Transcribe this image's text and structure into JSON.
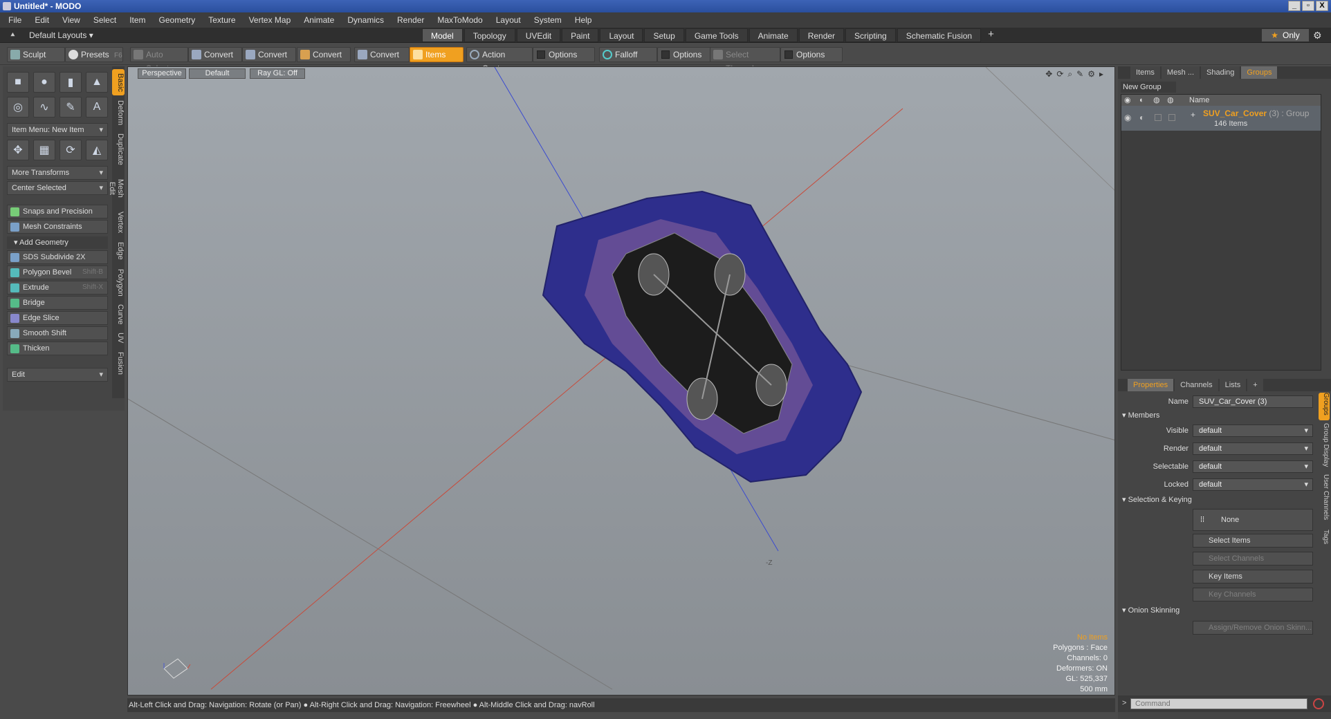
{
  "window": {
    "title": "Untitled* - MODO",
    "buttons": [
      "_",
      "▫",
      "X"
    ]
  },
  "menu": [
    "File",
    "Edit",
    "View",
    "Select",
    "Item",
    "Geometry",
    "Texture",
    "Vertex Map",
    "Animate",
    "Dynamics",
    "Render",
    "MaxToModo",
    "Layout",
    "System",
    "Help"
  ],
  "layout": {
    "default_layouts": "Default Layouts ▾",
    "tabs": [
      "Model",
      "Topology",
      "UVEdit",
      "Paint",
      "Layout",
      "Setup",
      "Game Tools",
      "Animate",
      "Render",
      "Scripting",
      "Schematic Fusion"
    ],
    "active_tab": "Model",
    "plus": "+",
    "only_label": "Only"
  },
  "toolbar": {
    "sculpt": "Sculpt",
    "presets": "Presets",
    "presets_shortcut": "F6",
    "auto_select": "Auto Select",
    "convert1": "Convert",
    "convert2": "Convert",
    "convert3": "Convert",
    "convert4": "Convert",
    "items": "Items",
    "action_center": "Action Center",
    "options1": "Options",
    "falloff": "Falloff",
    "options2": "Options",
    "select_through": "Select Through",
    "options3": "Options"
  },
  "left": {
    "item_menu": "Item Menu: New Item",
    "more_transforms": "More Transforms",
    "center_selected": "Center Selected",
    "snaps": "Snaps and Precision",
    "mesh_constraints": "Mesh Constraints",
    "add_geometry": "Add Geometry",
    "tools": [
      {
        "label": "SDS Subdivide 2X",
        "shortcut": ""
      },
      {
        "label": "Polygon Bevel",
        "shortcut": "Shift-B"
      },
      {
        "label": "Extrude",
        "shortcut": "Shift-X"
      },
      {
        "label": "Bridge",
        "shortcut": ""
      },
      {
        "label": "Edge Slice",
        "shortcut": ""
      },
      {
        "label": "Smooth Shift",
        "shortcut": ""
      },
      {
        "label": "Thicken",
        "shortcut": ""
      }
    ],
    "edit": "Edit",
    "vtabs": [
      "Basic",
      "Deform",
      "Duplicate",
      "Mesh Edit",
      "Vertex",
      "Edge",
      "Polygon",
      "Curve",
      "UV",
      "Fusion"
    ]
  },
  "viewport": {
    "perspective": "Perspective",
    "default": "Default",
    "raygl": "Ray GL: Off",
    "stats": {
      "no_items": "No Items",
      "polygons": "Polygons : Face",
      "channels": "Channels: 0",
      "deformers": "Deformers: ON",
      "gl": "GL: 525,337",
      "scale": "500 mm"
    },
    "neg_z": "-Z"
  },
  "status": "Alt-Left Click and Drag: Navigation: Rotate (or Pan) ● Alt-Right Click and Drag: Navigation: Freewheel ● Alt-Middle Click and Drag: navRoll",
  "right": {
    "tabs": [
      "Items",
      "Mesh ...",
      "Shading",
      "Groups"
    ],
    "active_tab": "Groups",
    "new_group": "New Group",
    "name_col": "Name",
    "group_name": "SUV_Car_Cover",
    "group_suffix": " (3) : Group",
    "group_count": "146 Items",
    "prop_tabs": [
      "Properties",
      "Channels",
      "Lists",
      "+"
    ],
    "name_label": "Name",
    "name_value": "SUV_Car_Cover (3)",
    "members": "Members",
    "visible_label": "Visible",
    "render_label": "Render",
    "selectable_label": "Selectable",
    "locked_label": "Locked",
    "default_val": "default",
    "selection_keying": "Selection & Keying",
    "none": "None",
    "select_items": "Select Items",
    "select_channels": "Select Channels",
    "key_items": "Key Items",
    "key_channels": "Key Channels",
    "onion": "Onion Skinning",
    "assign_onion": "Assign/Remove Onion Skinn...",
    "rvtabs": [
      "Groups",
      "Group Display",
      "User Channels",
      "Tags"
    ],
    "command_placeholder": "Command"
  }
}
